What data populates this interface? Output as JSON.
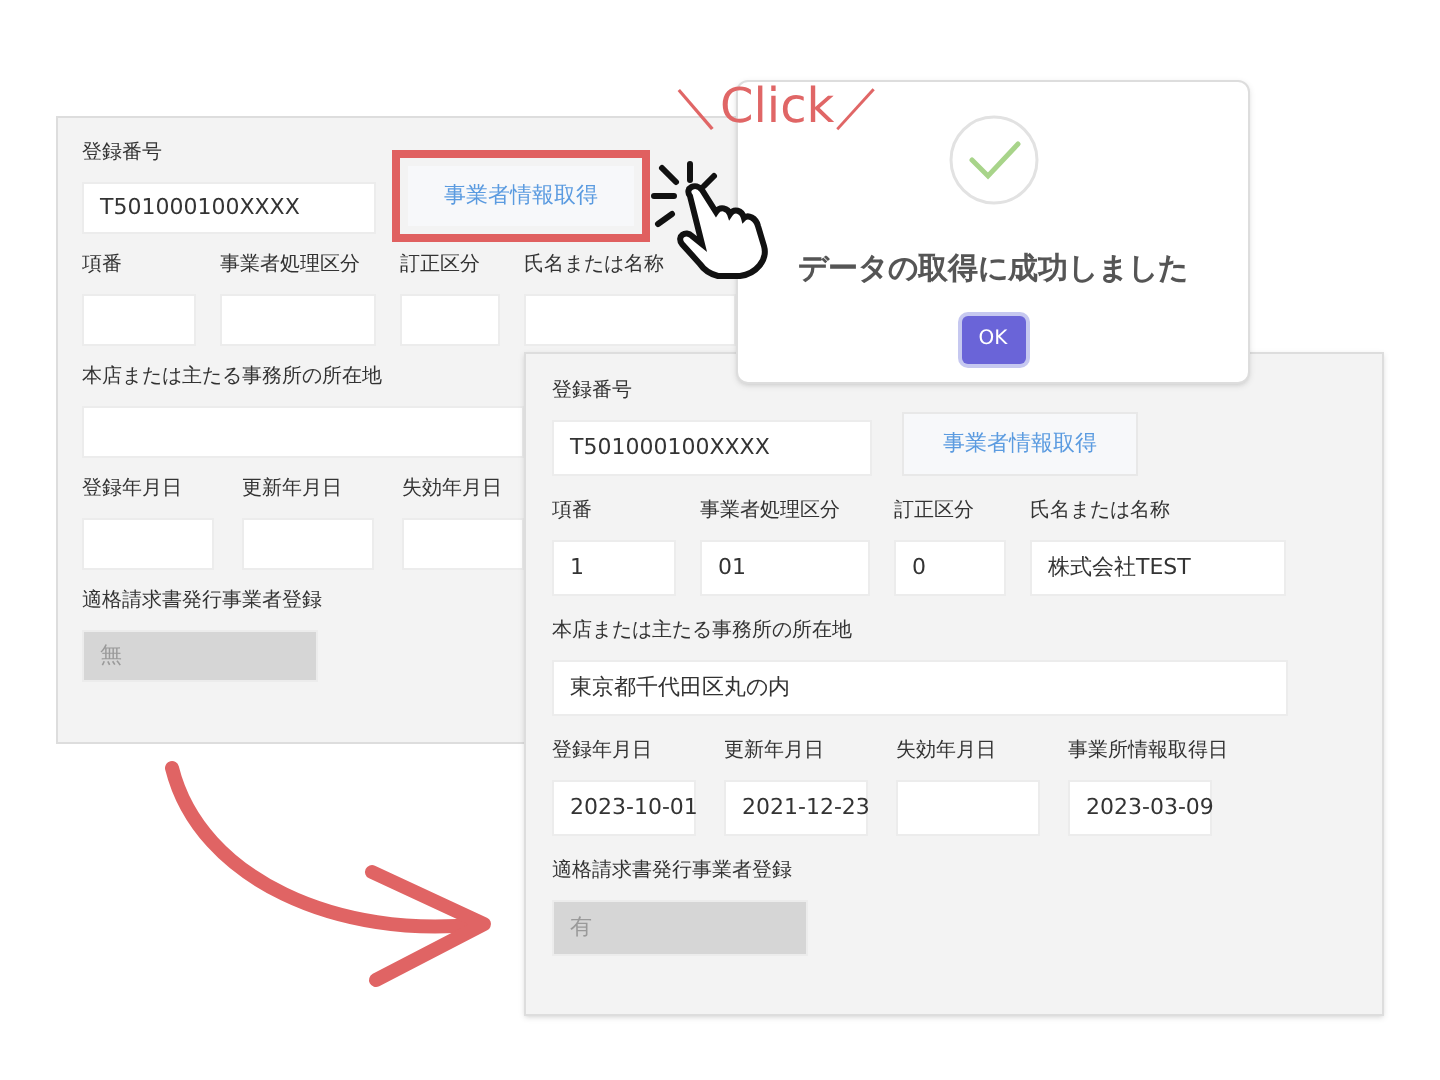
{
  "back_form": {
    "fetch_button": {
      "label": "事業者情報取得",
      "highlighted": true
    },
    "rows": [
      [
        {
          "label": "登録番号",
          "value": "T501000100XXXX"
        }
      ],
      [
        {
          "label": "項番"
        },
        {
          "label": "事業者処理区分"
        },
        {
          "label": "訂正区分"
        },
        {
          "label": "氏名または名称"
        }
      ],
      [
        {
          "label": "本店または主たる事務所の所在地"
        }
      ],
      [
        {
          "label": "登録年月日"
        },
        {
          "label": "更新年月日"
        },
        {
          "label": "失効年月日"
        }
      ],
      [
        {
          "label": "適格請求書発行事業者登録",
          "value": "無",
          "disabled": true
        }
      ]
    ]
  },
  "click_caption": "＼Click／",
  "dialog": {
    "message": "データの取得に成功しました",
    "button": "OK"
  },
  "front_form": {
    "fetch_button": {
      "label": "事業者情報取得",
      "highlighted": false
    },
    "rows": [
      [
        {
          "label": "登録番号",
          "value": "T501000100XXXX"
        }
      ],
      [
        {
          "label": "項番",
          "value": "1"
        },
        {
          "label": "事業者処理区分",
          "value": "01"
        },
        {
          "label": "訂正区分",
          "value": "0"
        },
        {
          "label": "氏名または名称",
          "value": "株式会社TEST"
        }
      ],
      [
        {
          "label": "本店または主たる事務所の所在地",
          "value": "東京都千代田区丸の内"
        }
      ],
      [
        {
          "label": "登録年月日",
          "value": "2023-10-01"
        },
        {
          "label": "更新年月日",
          "value": "2021-12-23"
        },
        {
          "label": "失効年月日"
        },
        {
          "label": "事業所情報取得日",
          "value": "2023-03-09"
        }
      ],
      [
        {
          "label": "適格請求書発行事業者登録",
          "value": "有",
          "disabled": true
        }
      ]
    ]
  }
}
